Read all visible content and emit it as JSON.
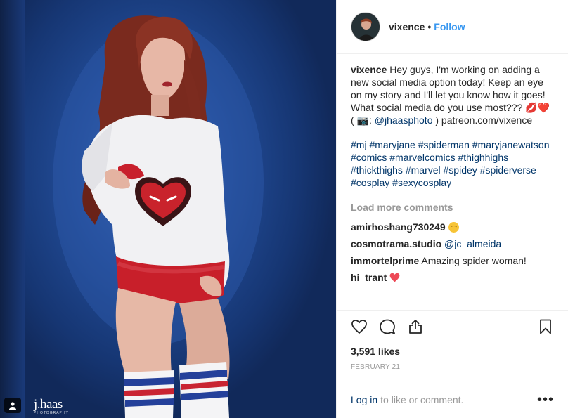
{
  "post": {
    "photo": {
      "watermark_main": "j.haas",
      "watermark_sub": "PHOTOGRAPHY"
    },
    "author": {
      "username": "vixence",
      "separator": "•",
      "follow_label": "Follow"
    },
    "caption": {
      "username": "vixence",
      "text_1": "Hey guys, I'm working on adding a new social media option today! Keep an eye on my story and I'll let you know how it goes! What social media do you use most???",
      "emojis_1": "💋❤️",
      "text_2_prefix": "( 📷: ",
      "photographer": "@jhaasphoto",
      "text_2_suffix": " ) patreon.com/vixence",
      "hashtags": [
        "#mj",
        "#maryjane",
        "#spiderman",
        "#maryjanewatson",
        "#comics",
        "#marvelcomics",
        "#thighhighs",
        "#thickthighs",
        "#marvel",
        "#spidey",
        "#spiderverse",
        "#cosplay",
        "#sexycosplay"
      ]
    },
    "load_more_label": "Load more comments",
    "comments": [
      {
        "username": "amirhoshang730249",
        "text": "",
        "emoji": "smile"
      },
      {
        "username": "cosmotrama.studio",
        "text": "",
        "mention": "@jc_almeida"
      },
      {
        "username": "immortelprime",
        "text": "Amazing spider woman!"
      },
      {
        "username": "hi_trant",
        "text": "",
        "emoji": "heart"
      }
    ],
    "actions": {
      "like": "heart-outline-icon",
      "comment": "comment-bubble-icon",
      "share": "share-icon",
      "save": "bookmark-icon"
    },
    "likes": "3,591 likes",
    "date": "FEBRUARY 21",
    "login": {
      "link_label": "Log in",
      "text": "to like or comment.",
      "more_label": "•••"
    },
    "colors": {
      "link": "#3897f0",
      "hashtag": "#003569",
      "heart": "#ed4956"
    }
  }
}
